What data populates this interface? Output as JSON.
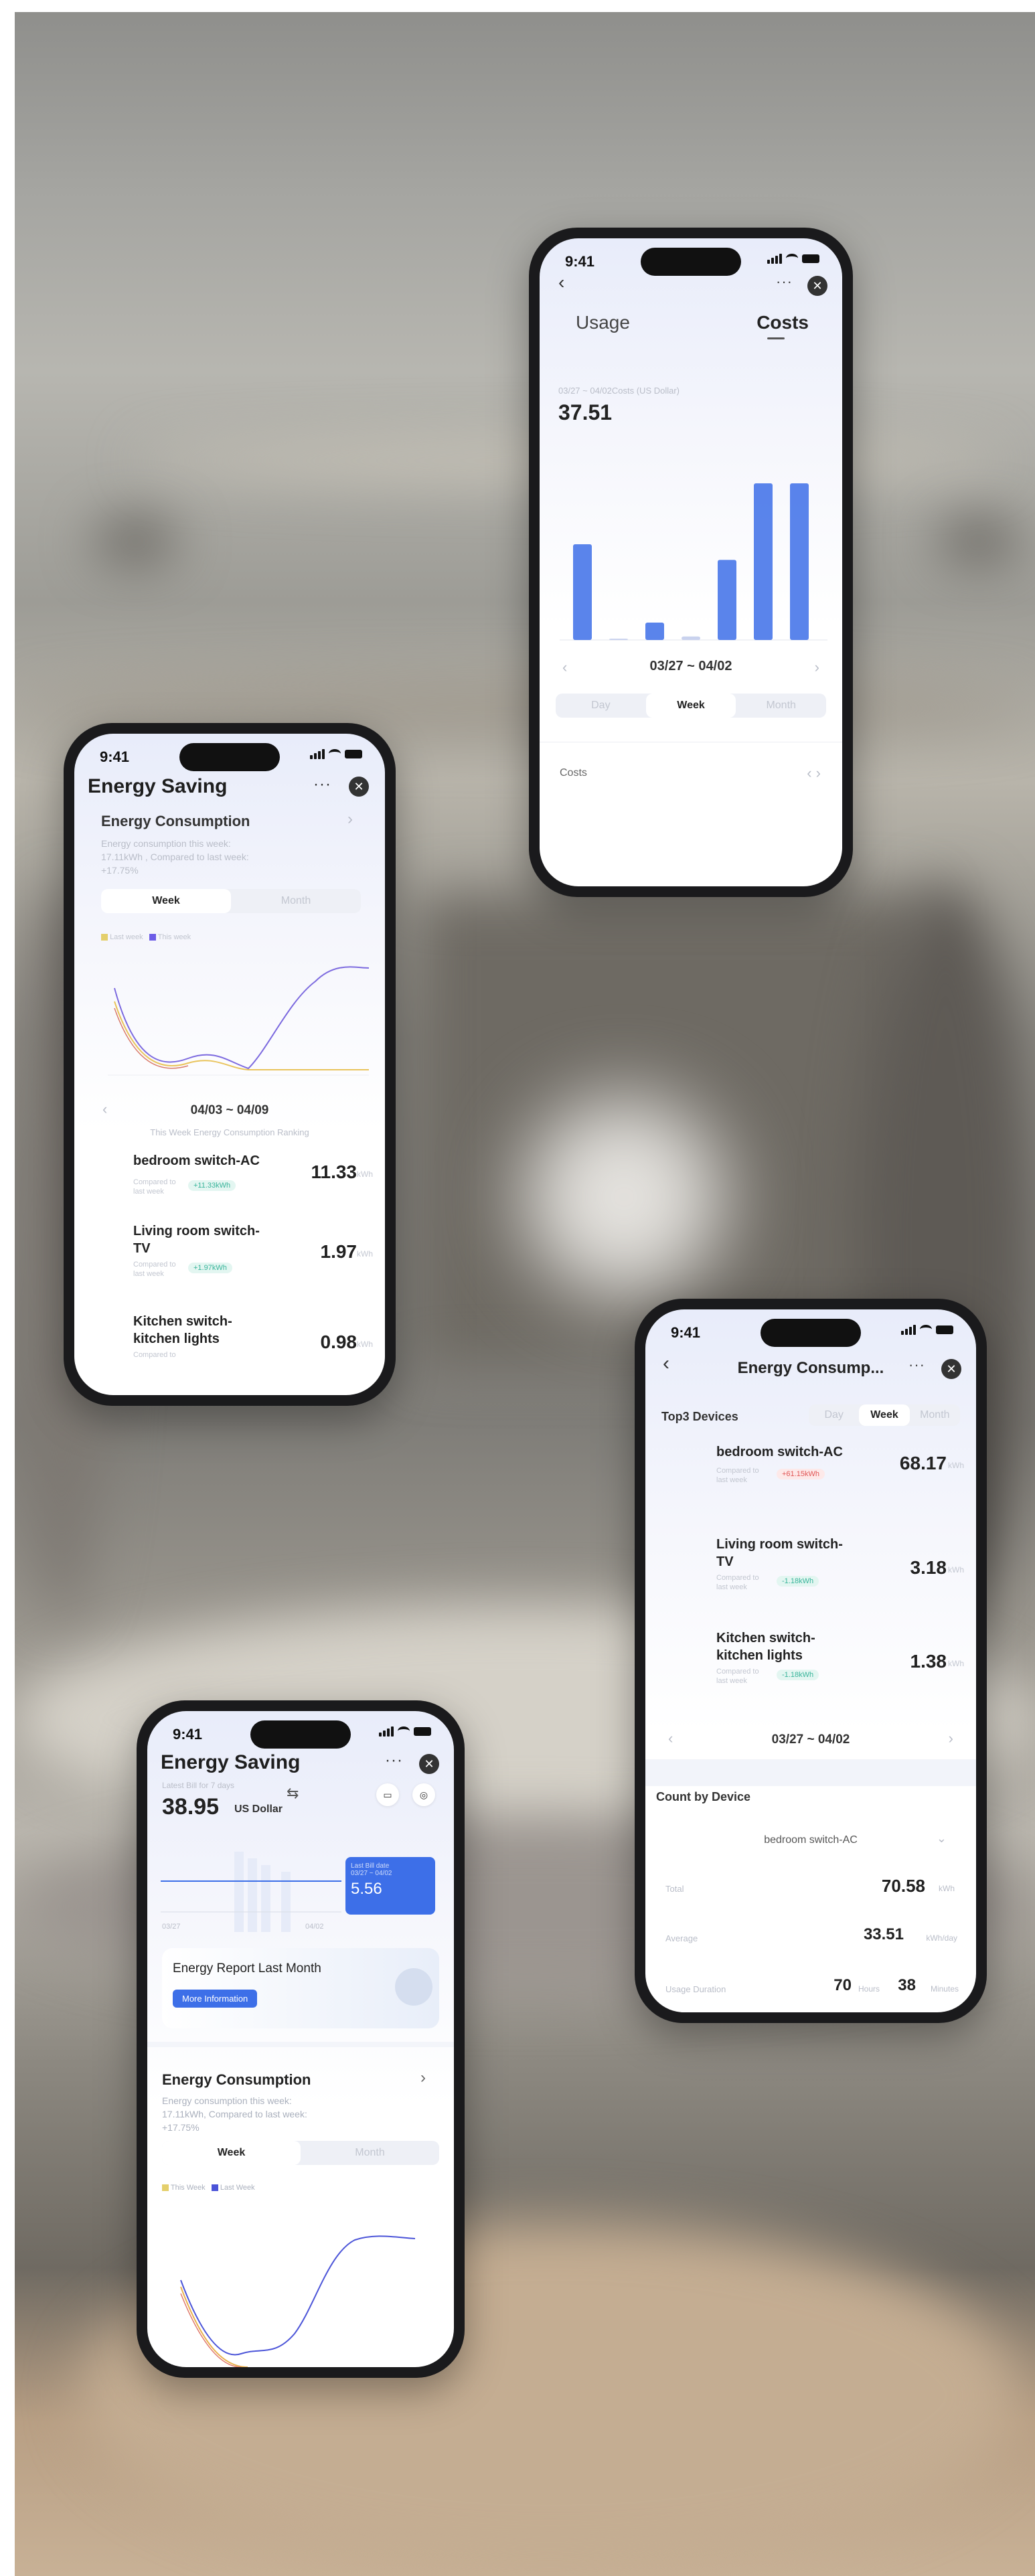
{
  "phoneA": {
    "time": "9:41",
    "tab_usage": "Usage",
    "tab_costs": "Costs",
    "period_caption": "03/27 ~ 04/02Costs  (US Dollar)",
    "total": "37.51",
    "range": "03/27 ~ 04/02",
    "seg": [
      "Day",
      "Week",
      "Month"
    ],
    "costs_label": "Costs",
    "bar_values": [
      0.55,
      0,
      0.1,
      0.02,
      0.46,
      0.9,
      0.9
    ],
    "accent": "#3d6fe8"
  },
  "phoneB": {
    "time": "9:41",
    "title": "Energy Saving",
    "section_title": "Energy Consumption",
    "summary_line1": "Energy consumption this week:",
    "summary_line2": "17.11kWh , Compared to last week:",
    "summary_line3": "+17.75%",
    "seg": [
      "Week",
      "Month"
    ],
    "legend_last": "Last week",
    "legend_this": "This week",
    "range": "04/03 ~ 04/09",
    "ranking_caption": "This Week Energy Consumption Ranking",
    "devices": [
      {
        "name_1": "bedroom switch-AC",
        "name_2": "",
        "value": "11.33",
        "unit": "kWh",
        "sub": "Compared to last week",
        "pill": "+11.33kWh"
      },
      {
        "name_1": "Living room switch-",
        "name_2": "TV",
        "value": "1.97",
        "unit": "kWh",
        "sub": "Compared to last week",
        "pill": "+1.97kWh"
      },
      {
        "name_1": "Kitchen switch-",
        "name_2": "kitchen lights",
        "value": "0.98",
        "unit": "kWh",
        "sub": "Compared to",
        "pill": ""
      }
    ]
  },
  "phoneC": {
    "time": "9:41",
    "title": "Energy Consump...",
    "top_label": "Top3 Devices",
    "seg": [
      "Day",
      "Week",
      "Month"
    ],
    "devices": [
      {
        "name_1": "bedroom switch-AC",
        "name_2": "",
        "value": "68.17",
        "unit": "kWh",
        "sub": "Compared to last week",
        "pill": "+61.15kWh"
      },
      {
        "name_1": "Living room switch-",
        "name_2": "TV",
        "value": "3.18",
        "unit": "kWh",
        "sub": "Compared to last week",
        "pill": "-1.18kWh"
      },
      {
        "name_1": "Kitchen switch-",
        "name_2": "kitchen lights",
        "value": "1.38",
        "unit": "kWh",
        "sub": "Compared to last week",
        "pill": "-1.18kWh"
      }
    ],
    "range": "03/27 ~ 04/02",
    "count_label": "Count by Device",
    "device_select": "bedroom switch-AC",
    "rows": [
      {
        "label": "Total",
        "value": "70.58",
        "unit": "kWh"
      },
      {
        "label": "Average",
        "value": "33.51",
        "unit": "kWh/day"
      },
      {
        "label": "Usage Duration",
        "value": "70",
        "unit": "Hours",
        "value2": "38",
        "unit2": "Minutes"
      }
    ]
  },
  "phoneD": {
    "time": "9:41",
    "title": "Energy Saving",
    "caption": "Latest Bill for 7 days",
    "total": "38.95",
    "currency": "US Dollar",
    "tooltip_line1": "Last Bill date",
    "tooltip_line2": "03/27 ~ 04/02",
    "tooltip_value": "5.56",
    "axis_start": "03/27",
    "axis_end": "04/02",
    "report_title": "Energy Report Last Month",
    "report_button": "More Information",
    "section_title": "Energy Consumption",
    "summary_line1": "Energy consumption this week:",
    "summary_line2": "17.11kWh, Compared to last week:",
    "summary_line3": "+17.75%",
    "seg": [
      "Week",
      "Month"
    ],
    "legend_this": "This Week",
    "legend_last": "Last Week"
  }
}
